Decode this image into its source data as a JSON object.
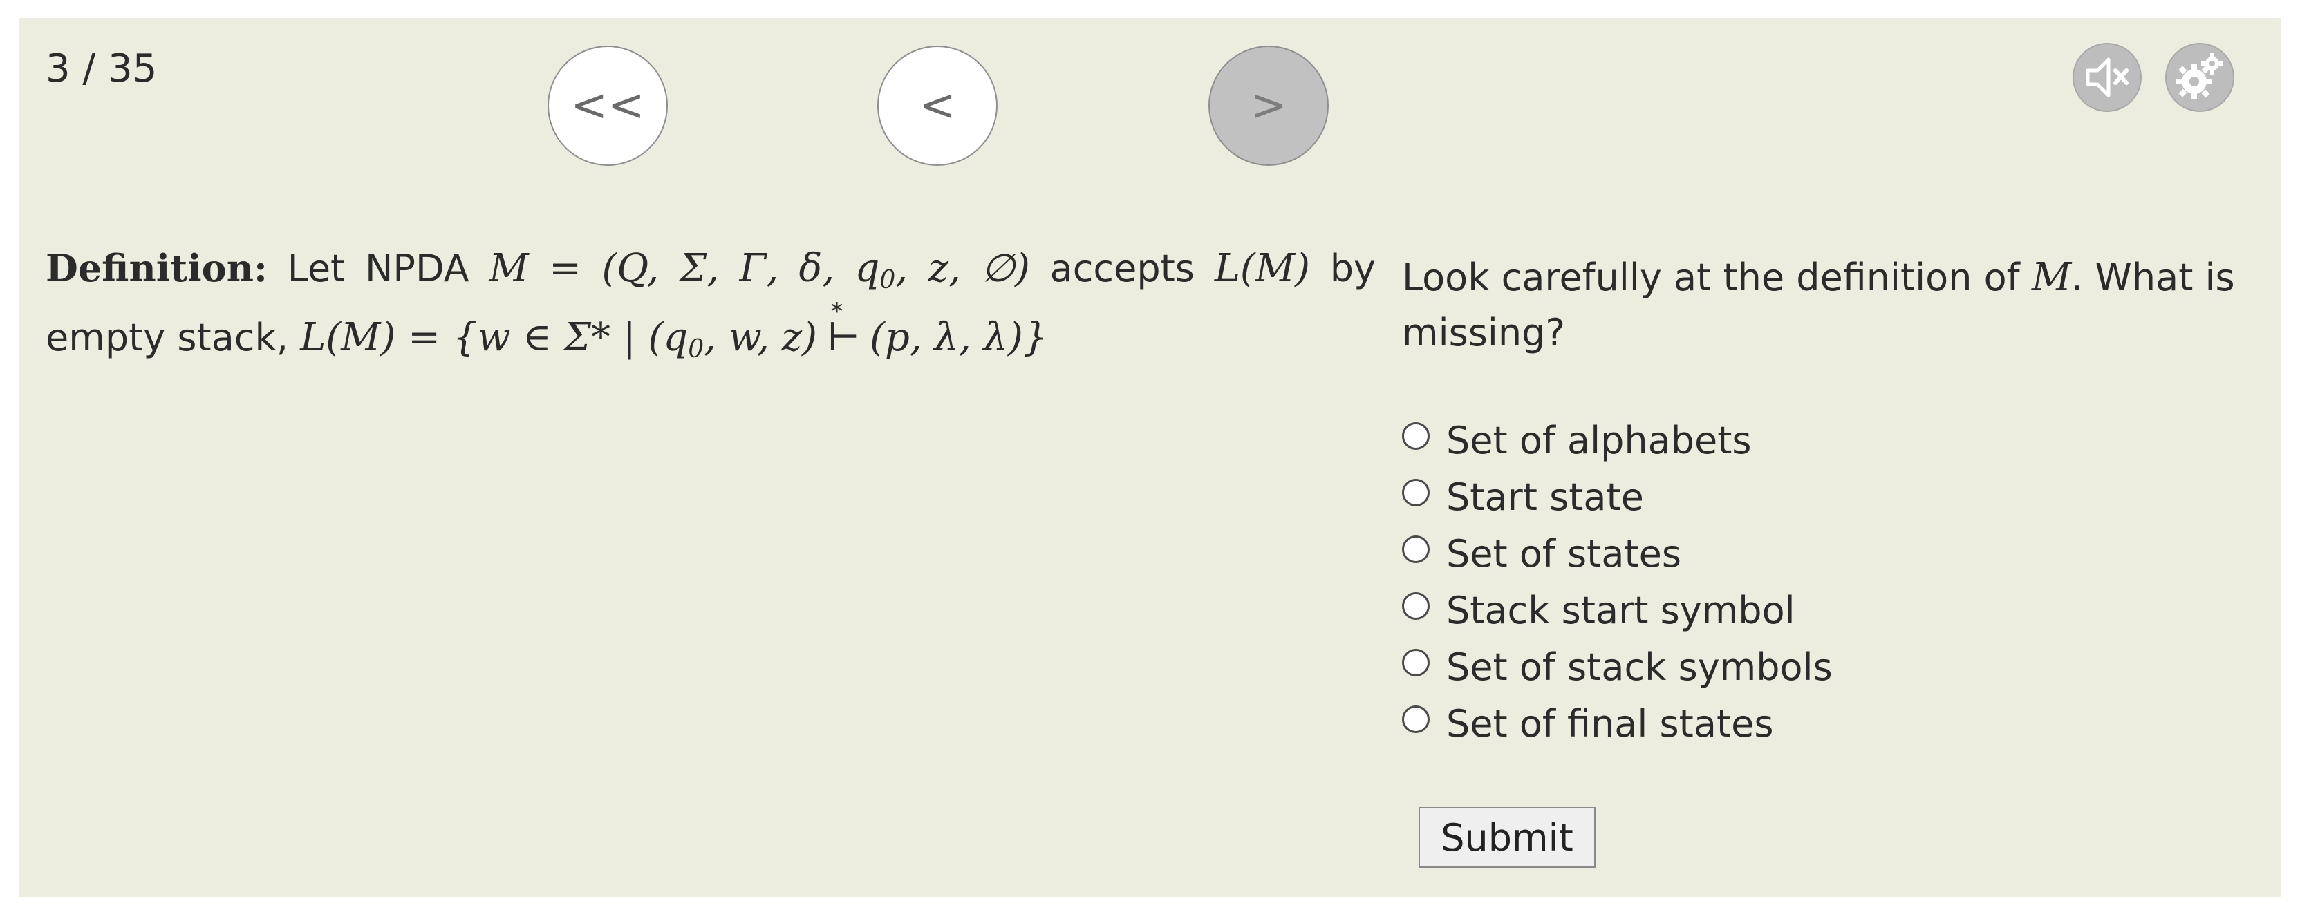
{
  "progress": {
    "counter": "3 / 35"
  },
  "nav": {
    "first_label": "<<",
    "prev_label": "<",
    "next_label": ">"
  },
  "toolbar": {
    "icons": [
      "speaker-muted-icon",
      "gear-icon"
    ]
  },
  "definition": {
    "label": "Definition:",
    "text_1": "Let NPDA",
    "tuple": "M = (Q, Σ, Γ, δ, q",
    "tuple_sub": "0",
    "tuple_end": ", z, ∅)",
    "text_2": "accepts",
    "lm": "L(M)",
    "text_3": "by empty stack,",
    "set_start": "L(M) = {w ∈ Σ* | (q",
    "set_sub": "0",
    "set_mid": ", w, z)",
    "turnstile": "⊢",
    "turnstile_star": "*",
    "set_end": "(p, λ, λ)}"
  },
  "question": {
    "text_before": "Look carefully at the definition of",
    "symbol": "M",
    "text_after": ". What is missing?"
  },
  "options": [
    {
      "label": "Set of alphabets"
    },
    {
      "label": "Start state"
    },
    {
      "label": "Set of states"
    },
    {
      "label": "Stack start symbol"
    },
    {
      "label": "Set of stack symbols"
    },
    {
      "label": "Set of final states"
    }
  ],
  "submit_label": "Submit"
}
